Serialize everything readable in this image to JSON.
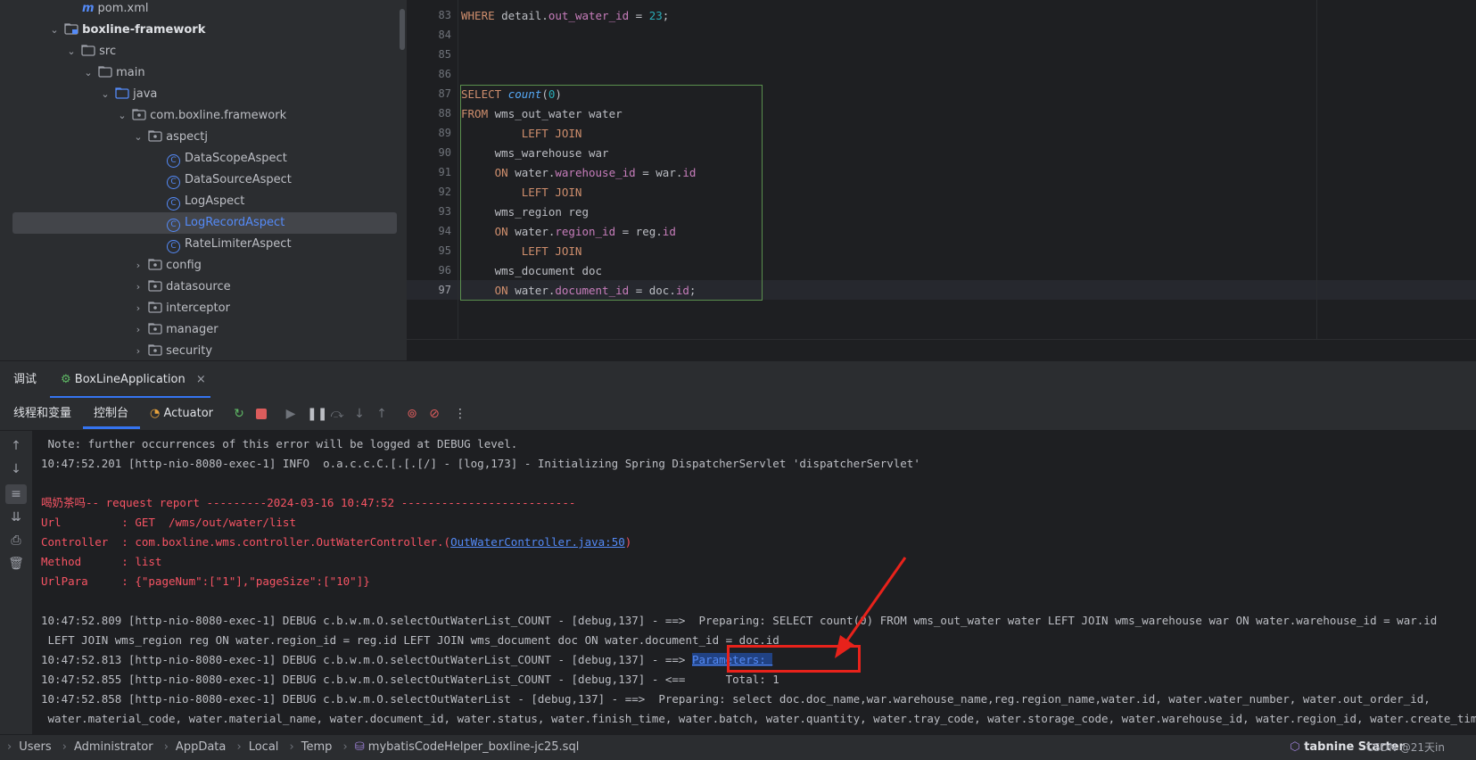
{
  "tree": {
    "items": [
      {
        "label": "pom.xml"
      },
      {
        "label": "boxline-framework"
      },
      {
        "label": "src"
      },
      {
        "label": "main"
      },
      {
        "label": "java"
      },
      {
        "label": "com.boxline.framework"
      },
      {
        "label": "aspectj"
      },
      {
        "label": "DataScopeAspect"
      },
      {
        "label": "DataSourceAspect"
      },
      {
        "label": "LogAspect"
      },
      {
        "label": "LogRecordAspect"
      },
      {
        "label": "RateLimiterAspect"
      },
      {
        "label": "config"
      },
      {
        "label": "datasource"
      },
      {
        "label": "interceptor"
      },
      {
        "label": "manager"
      },
      {
        "label": "security"
      }
    ],
    "maven_glyph": "m"
  },
  "editor": {
    "line_numbers": [
      "83",
      "84",
      "85",
      "86",
      "87",
      "88",
      "89",
      "90",
      "91",
      "92",
      "93",
      "94",
      "95",
      "96",
      "97"
    ]
  },
  "debug": {
    "tab_debug": "调试",
    "tab_app": "BoxLineApplication",
    "threads_label": "线程和变量",
    "console_label": "控制台",
    "actuator_label": "Actuator"
  },
  "console": {
    "lines": [
      " Note: further occurrences of this error will be logged at DEBUG level.",
      "10:47:52.201 [http-nio-8080-exec-1] INFO  o.a.c.c.C.[.[.[/] - [log,173] - Initializing Spring DispatcherServlet 'dispatcherServlet'",
      "喝奶茶吗-- request report ---------2024-03-16 10:47:52 --------------------------",
      "Url         : GET  /wms/out/water/list",
      "Controller  : com.boxline.wms.controller.OutWaterController.(",
      "OutWaterController.java:50",
      ")",
      "Method      : list",
      "UrlPara     : {\"pageNum\":[\"1\"],\"pageSize\":[\"10\"]}",
      "10:47:52.809 [http-nio-8080-exec-1] DEBUG c.b.w.m.O.selectOutWaterList_COUNT - [debug,137] - ==>  Preparing: SELECT count(0) FROM wms_out_water water LEFT JOIN wms_warehouse war ON water.warehouse_id = war.id",
      " LEFT JOIN wms_region reg ON water.region_id = reg.id LEFT JOIN wms_document doc ON water.document_id = doc.id",
      "10:47:52.813 [http-nio-8080-exec-1] DEBUG c.b.w.m.O.selectOutWaterList_COUNT - [debug,137] - ==> ",
      "Parameters: ",
      "10:47:52.855 [http-nio-8080-exec-1] DEBUG c.b.w.m.O.selectOutWaterList_COUNT - [debug,137] - <==      Total: 1",
      "10:47:52.858 [http-nio-8080-exec-1] DEBUG c.b.w.m.O.selectOutWaterList - [debug,137] - ==>  Preparing: select doc.doc_name,war.warehouse_name,reg.region_name,water.id, water.water_number, water.out_order_id,",
      " water.material_code, water.material_name, water.document_id, water.status, water.finish_time, water.batch, water.quantity, water.tray_code, water.storage_code, water.warehouse_id, water.region_id, water.create_time"
    ]
  },
  "breadcrumb": {
    "items": [
      "Users",
      "Administrator",
      "AppData",
      "Local",
      "Temp",
      "mybatisCodeHelper_boxline-jc25.sql"
    ]
  },
  "status": {
    "tabnine": "tabnine Starter",
    "watermark": "CSDN @21天in"
  },
  "colors": {
    "accent": "#3574f0",
    "annotation_red": "#e8221b"
  }
}
